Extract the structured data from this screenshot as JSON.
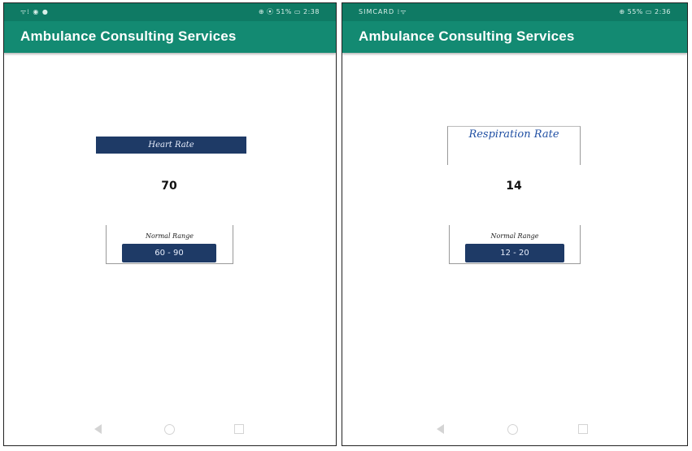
{
  "screens": [
    {
      "status_bar": {
        "left": "ᯤ⁞ ◉ ●",
        "right": "⊕ ⦿ 51% ▭ 2:38"
      },
      "app_title": "Ambulance Consulting Services",
      "vital_label": "Heart Rate",
      "vital_value": "70",
      "range_caption": "Normal Range",
      "range_value": "60 - 90"
    },
    {
      "status_bar": {
        "left": "SIMCARD ⁞ᯤ",
        "right": "⊕ 55% ▭ 2:36"
      },
      "app_title": "Ambulance Consulting Services",
      "vital_label": "Respiration Rate",
      "vital_value": "14",
      "range_caption": "Normal Range",
      "range_value": "12 - 20"
    }
  ],
  "colors": {
    "app_bar": "#138a72",
    "status_bar": "#0f7a64",
    "navy_box": "#1e3a66",
    "blue_text": "#1f4fa3"
  },
  "icons": {
    "nav_back": "triangle-back-icon",
    "nav_home": "circle-home-icon",
    "nav_recent": "square-recent-apps-icon"
  }
}
